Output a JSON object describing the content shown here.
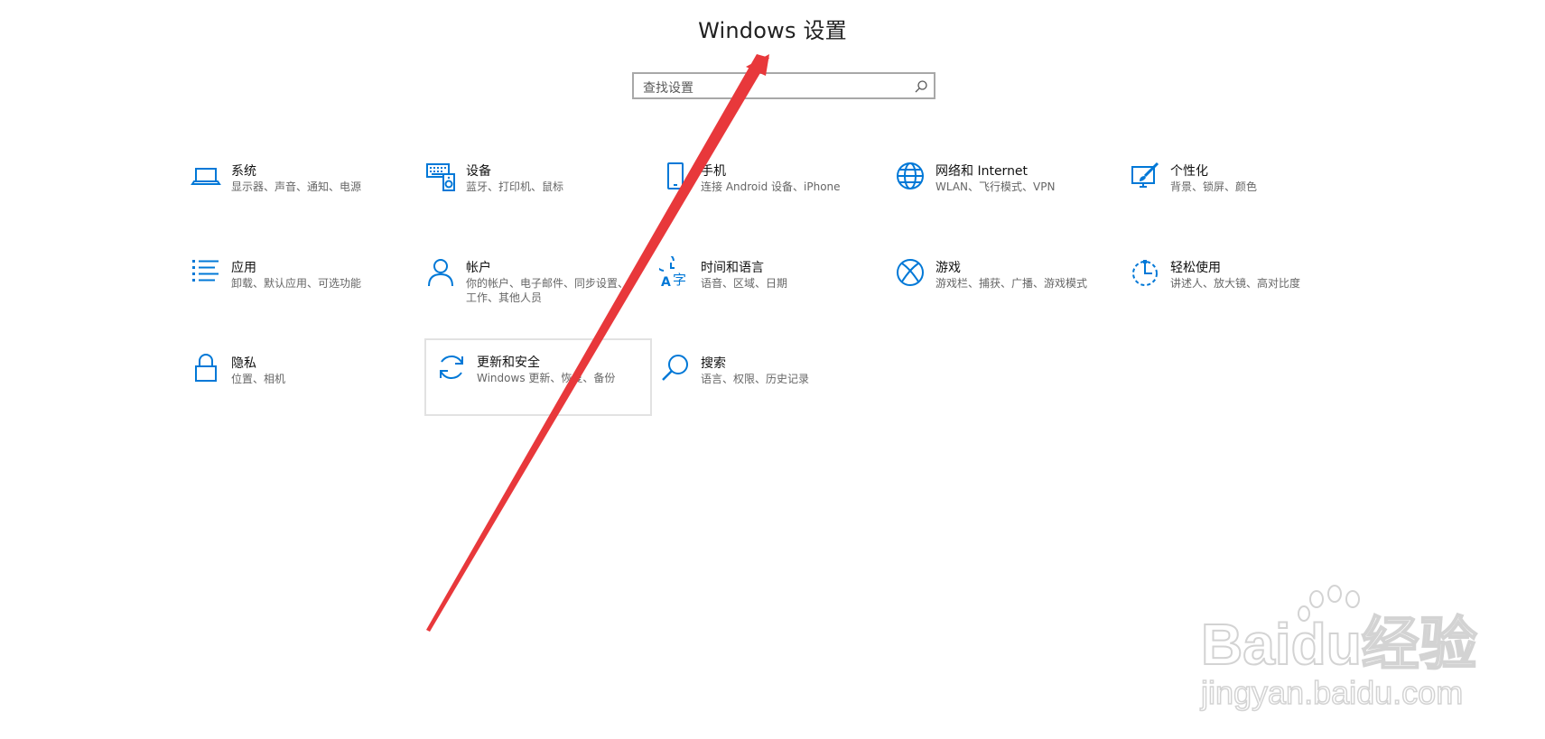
{
  "window": {
    "title": "Windows 设置"
  },
  "search": {
    "placeholder": "查找设置"
  },
  "accent_color": "#0078d7",
  "annotation_color": "#e8383b",
  "tiles": [
    {
      "name": "系统",
      "desc": "显示器、声音、通知、电源",
      "icon": "laptop-icon"
    },
    {
      "name": "设备",
      "desc": "蓝牙、打印机、鼠标",
      "icon": "keyboard-speaker-icon"
    },
    {
      "name": "手机",
      "desc": "连接 Android 设备、iPhone",
      "icon": "phone-icon"
    },
    {
      "name": "网络和 Internet",
      "desc": "WLAN、飞行模式、VPN",
      "icon": "globe-icon"
    },
    {
      "name": "个性化",
      "desc": "背景、锁屏、颜色",
      "icon": "paint-brush-icon"
    },
    {
      "name": "应用",
      "desc": "卸载、默认应用、可选功能",
      "icon": "app-list-icon"
    },
    {
      "name": "帐户",
      "desc": "你的帐户、电子邮件、同步设置、工作、其他人员",
      "icon": "person-icon"
    },
    {
      "name": "时间和语言",
      "desc": "语音、区域、日期",
      "icon": "time-language-icon"
    },
    {
      "name": "游戏",
      "desc": "游戏栏、捕获、广播、游戏模式",
      "icon": "xbox-icon"
    },
    {
      "name": "轻松使用",
      "desc": "讲述人、放大镜、高对比度",
      "icon": "ease-of-access-icon"
    },
    {
      "name": "隐私",
      "desc": "位置、相机",
      "icon": "lock-icon"
    },
    {
      "name": "更新和安全",
      "desc": "Windows 更新、恢复、备份",
      "icon": "sync-icon",
      "selected": true
    },
    {
      "name": "搜索",
      "desc": "语言、权限、历史记录",
      "icon": "search-magnifier-icon"
    }
  ],
  "watermark": {
    "brand_text": "Baidu经验",
    "url_text": "jingyan.baidu.com"
  }
}
